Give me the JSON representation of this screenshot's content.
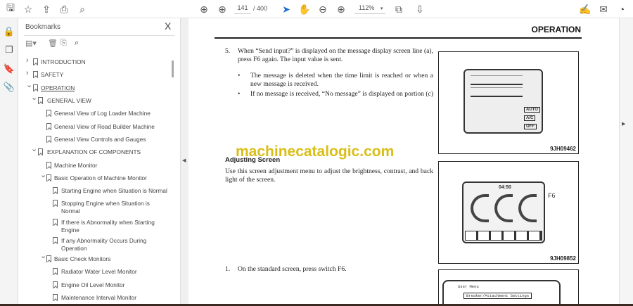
{
  "toolbar": {
    "page_current": "141",
    "page_total": "/ 400",
    "zoom": "112%"
  },
  "panel": {
    "title": "Bookmarks",
    "close": "X"
  },
  "bookmarks": [
    {
      "label": "INTRODUCTION",
      "level": 0,
      "chev": ">"
    },
    {
      "label": "SAFETY",
      "level": 0,
      "chev": ">"
    },
    {
      "label": "OPERATION",
      "level": 0,
      "chev": "v"
    },
    {
      "label": "GENERAL VIEW",
      "level": 1,
      "chev": "v"
    },
    {
      "label": "General View of Log Loader Machine",
      "level": 2
    },
    {
      "label": "General View of Road Builder Machine",
      "level": 2
    },
    {
      "label": "General View Controls and Gauges",
      "level": 2
    },
    {
      "label": "EXPLANATION OF COMPONENTS",
      "level": 1,
      "chev": "v"
    },
    {
      "label": "Machine Monitor",
      "level": 2
    },
    {
      "label": "Basic Operation of Machine Monitor",
      "level": 2,
      "chev": "v"
    },
    {
      "label": "Starting Engine when Situation is Normal",
      "level": 3
    },
    {
      "label": "Stopping Engine when Situation is Normal",
      "level": 3
    },
    {
      "label": "If there is Abnormality when Starting Engine",
      "level": 3
    },
    {
      "label": "If any Abnormality Occurs During Operation",
      "level": 3
    },
    {
      "label": "Basic Check Monitors",
      "level": 2,
      "chev": "v"
    },
    {
      "label": "Radiator Water Level Monitor",
      "level": 3
    },
    {
      "label": "Engine Oil Level Monitor",
      "level": 3
    },
    {
      "label": "Maintenance Interval Monitor",
      "level": 3
    }
  ],
  "document": {
    "header": "OPERATION",
    "step5_num": "5.",
    "step5": "When “Send input?” is displayed on the message display screen line (a), press F6 again. The input value is sent.",
    "bullet1": "The message is deleted when the time limit is reached or when a new message is received.",
    "bullet2": "If no message is received, “No message” is displayed on portion (c)",
    "watermark": "machinecatalogic.com",
    "section_title": "Adjusting Screen",
    "section_text": "Use this screen adjustment menu to adjust the brightness, contrast, and back light of the screen.",
    "step1_num": "1.",
    "step1": "On the standard screen, press switch F6.",
    "fig1_label": "9JH09462",
    "fig2_label": "9JH09852",
    "fig2_f6": "F6",
    "fig2_time": "04:50",
    "fig3_menu": "User Menu",
    "fig3_item": "Breaker/Attachment Settings",
    "fig1_keys": [
      "AUTO",
      "A/C",
      "OFF"
    ]
  }
}
